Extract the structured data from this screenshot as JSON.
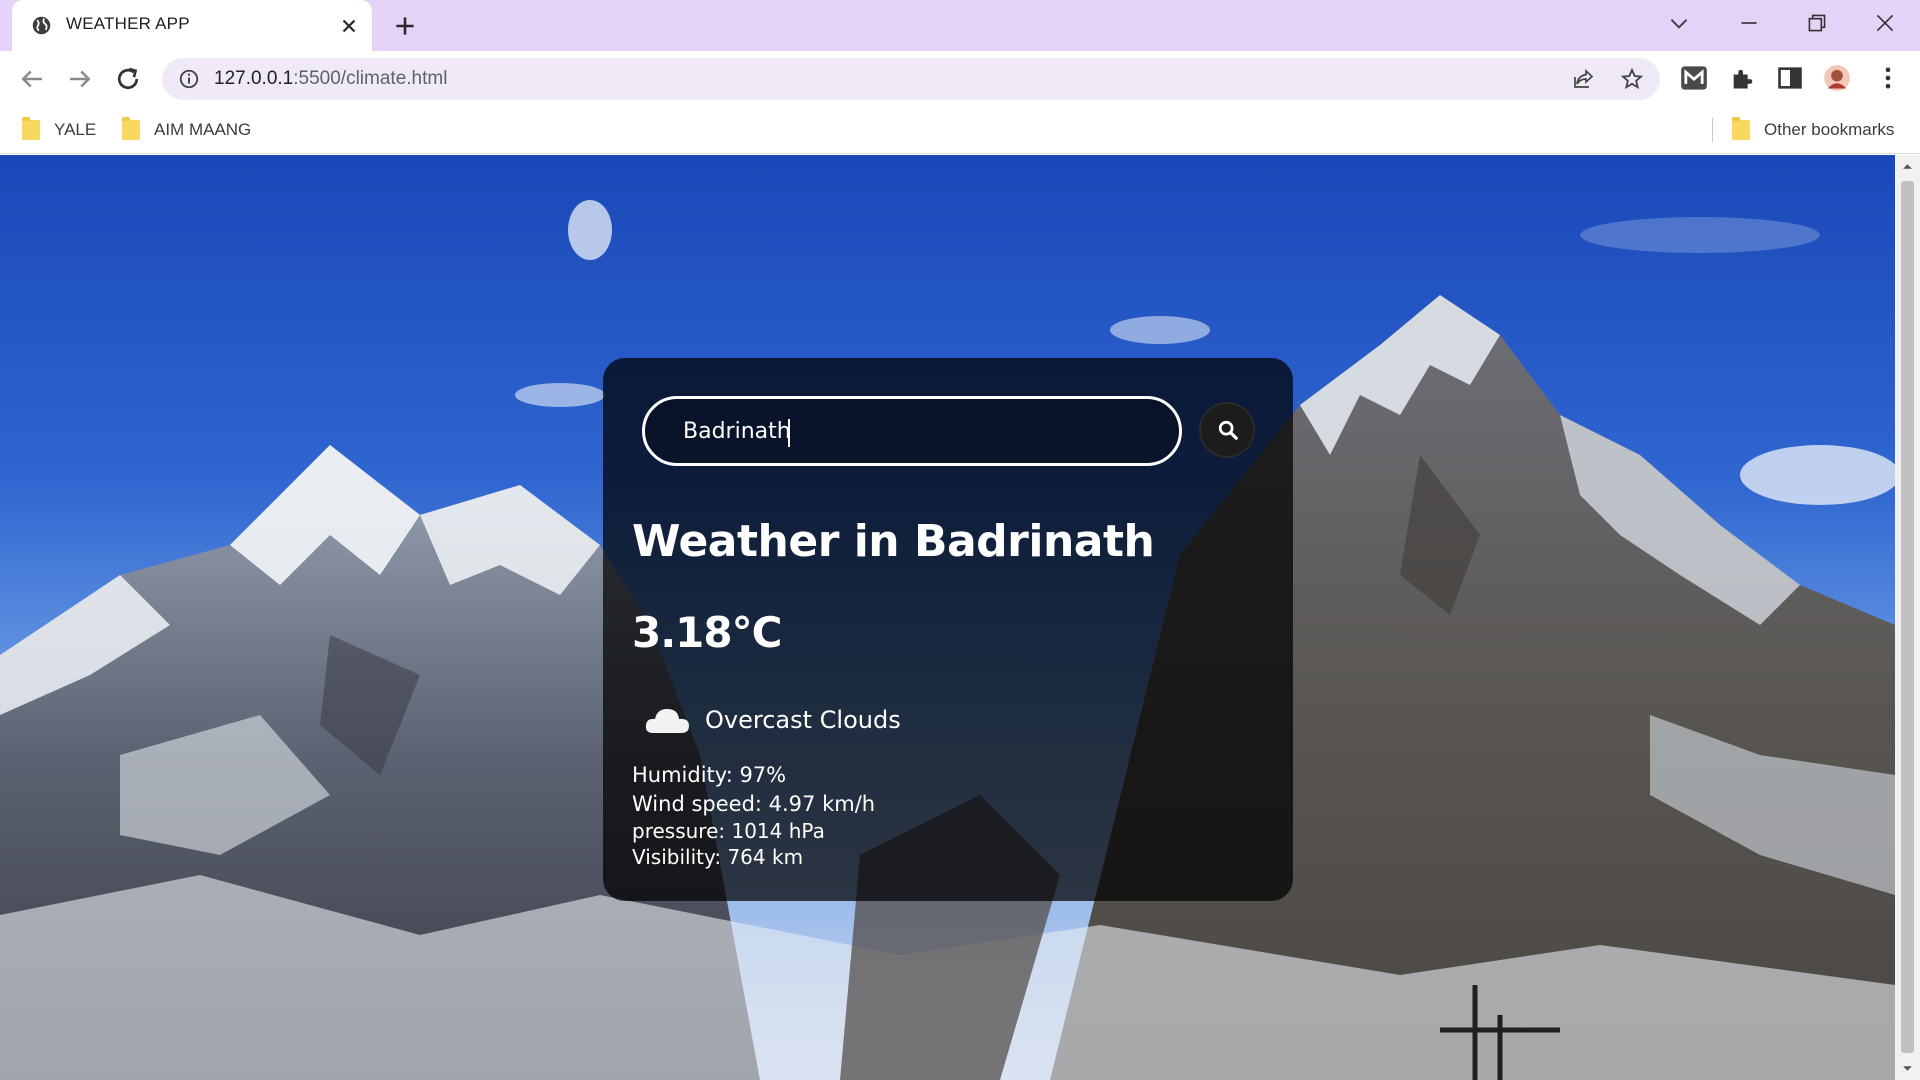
{
  "browser": {
    "tab_title": "WEATHER APP",
    "url_host": "127.0.0.1",
    "url_rest": ":5500/climate.html",
    "bookmarks": [
      {
        "label": "YALE",
        "icon": "folder-icon"
      },
      {
        "label": "AIM MAANG",
        "icon": "folder-icon"
      }
    ],
    "other_bookmarks": "Other bookmarks"
  },
  "weather": {
    "search_value": "Badrinath",
    "title": "Weather in Badrinath",
    "temperature": "3.18°C",
    "description": "Overcast Clouds",
    "description_icon": "cloud-icon",
    "humidity": "Humidity: 97%",
    "wind": "Wind speed: 4.97 km/h",
    "pressure": "pressure: 1014 hPa",
    "visibility": "Visibility: 764 km"
  },
  "colors": {
    "tabbar": "#e4d3f6",
    "card_bg": "rgba(0,0,0,0.72)"
  }
}
